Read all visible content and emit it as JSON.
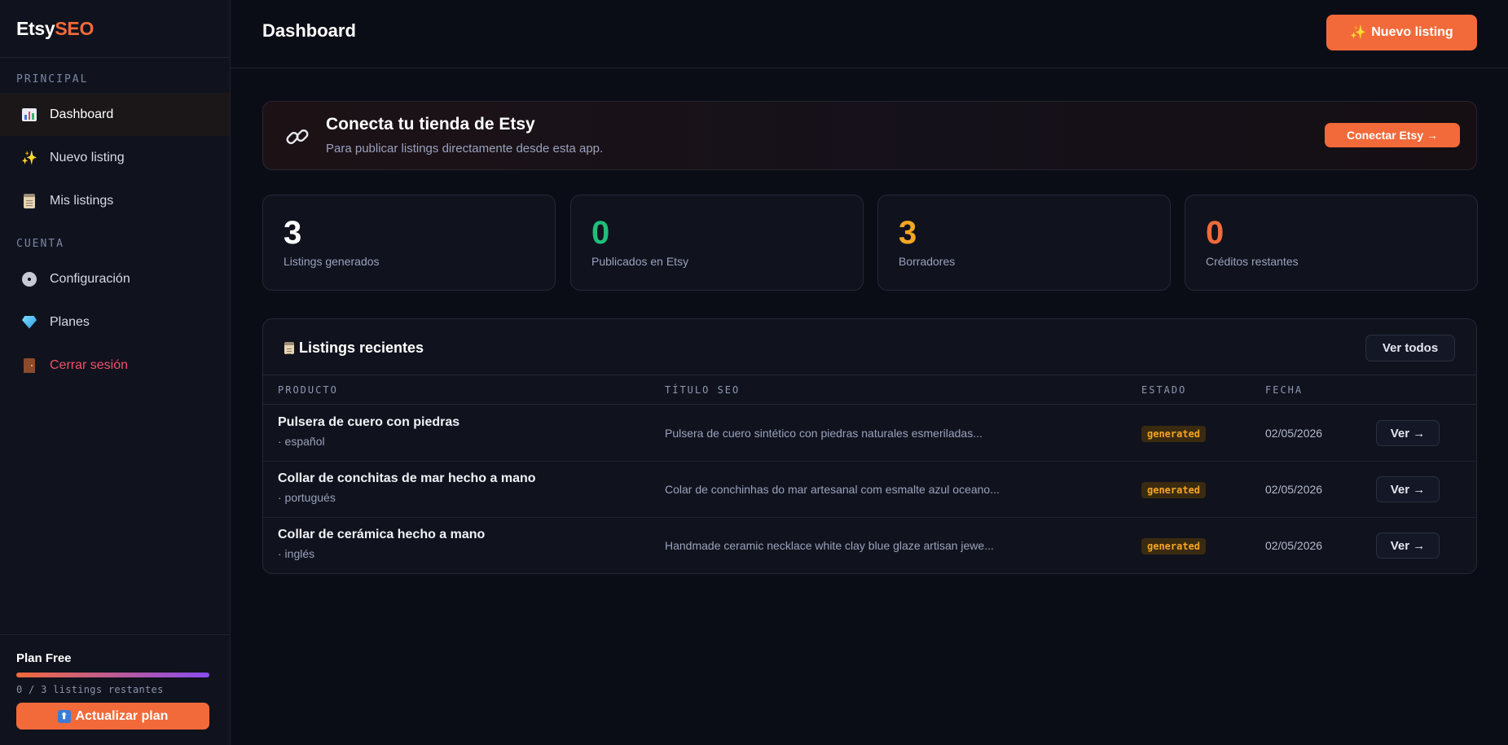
{
  "brand": {
    "part1": "Etsy",
    "part2": "SEO"
  },
  "sidebar": {
    "section_principal": "PRINCIPAL",
    "section_cuenta": "CUENTA",
    "principal_items": [
      {
        "label": "Dashboard",
        "icon": "chart-icon",
        "active": true
      },
      {
        "label": "Nuevo listing",
        "icon": "sparkles-icon"
      },
      {
        "label": "Mis listings",
        "icon": "clipboard-icon"
      }
    ],
    "cuenta_items": [
      {
        "label": "Configuración",
        "icon": "gear-icon"
      },
      {
        "label": "Planes",
        "icon": "gem-icon"
      },
      {
        "label": "Cerrar sesión",
        "icon": "door-icon"
      }
    ],
    "plan": {
      "title": "Plan Free",
      "usage": "0 / 3 listings restantes",
      "upgrade_label": "Actualizar plan",
      "upgrade_icon": "up-arrow-icon"
    }
  },
  "header": {
    "title": "Dashboard",
    "new_listing_label": "Nuevo listing"
  },
  "connect": {
    "title": "Conecta tu tienda de Etsy",
    "subtitle": "Para publicar listings directamente desde esta app.",
    "button_label": "Conectar Etsy →",
    "icon": "link-icon"
  },
  "stats": [
    {
      "value": "3",
      "label": "Listings generados",
      "color": "#ffffff"
    },
    {
      "value": "0",
      "label": "Publicados en Etsy",
      "color": "#1fbf7a"
    },
    {
      "value": "3",
      "label": "Borradores",
      "color": "#f5a623"
    },
    {
      "value": "0",
      "label": "Créditos restantes",
      "color": "#f26a3a"
    }
  ],
  "recent": {
    "title": "Listings recientes",
    "view_all_label": "Ver todos",
    "columns": [
      "PRODUCTO",
      "TÍTULO SEO",
      "ESTADO",
      "FECHA"
    ],
    "rows": [
      {
        "product": "Pulsera de cuero con piedras",
        "language": "· español",
        "seo_title": "Pulsera de cuero sintético con piedras naturales esmeriladas...",
        "status": "generated",
        "date": "02/05/2026",
        "action": "Ver →"
      },
      {
        "product": "Collar de conchitas de mar hecho a mano",
        "language": "· portugués",
        "seo_title": "Colar de conchinhas do mar artesanal com esmalte azul oceano...",
        "status": "generated",
        "date": "02/05/2026",
        "action": "Ver →"
      },
      {
        "product": "Collar de cerámica hecho a mano",
        "language": "· inglés",
        "seo_title": "Handmade ceramic necklace white clay blue glaze artisan jewe...",
        "status": "generated",
        "date": "02/05/2026",
        "action": "Ver →"
      }
    ]
  },
  "colors": {
    "accent": "#f26a3a",
    "background": "#0b0d16",
    "sidebar": "#10131d",
    "status_generated": "#f5a623",
    "logout": "#f0506a"
  }
}
